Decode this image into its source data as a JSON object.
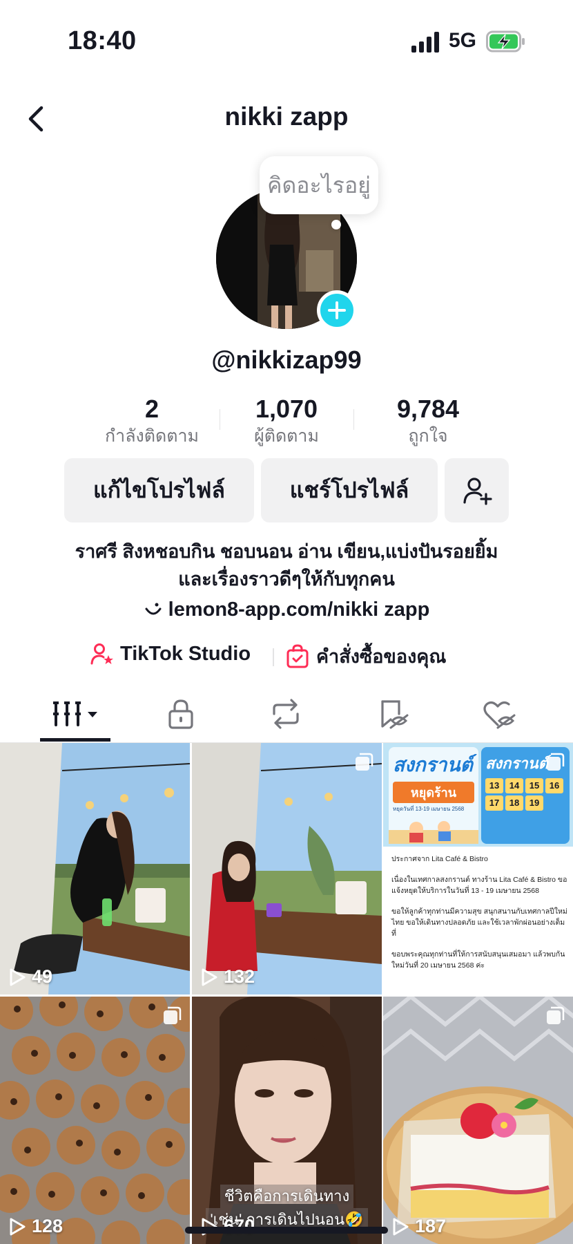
{
  "status_bar": {
    "time": "18:40",
    "network": "5G"
  },
  "header": {
    "title": "nikki zapp"
  },
  "profile": {
    "status_bubble": "คิดอะไรอยู่",
    "username": "@nikkizap99"
  },
  "stats": [
    {
      "value": "2",
      "label": "กำลังติดตาม"
    },
    {
      "value": "1,070",
      "label": "ผู้ติดตาม"
    },
    {
      "value": "9,784",
      "label": "ถูกใจ"
    }
  ],
  "buttons": {
    "edit": "แก้ไขโปรไฟล์",
    "share": "แชร์โปรไฟล์"
  },
  "bio": {
    "line1": "ราศรี สิงหชอบกิน ชอบนอน อ่าน เขียน,แบ่งปันรอยยิ้ม",
    "line2": "และเรื่องราวดีๆให้กับทุกคน",
    "link": "lemon8-app.com/nikki zapp"
  },
  "extras": {
    "studio": "TikTok Studio",
    "orders": "คำสั่งซื้อของคุณ"
  },
  "videos": [
    {
      "views": "49"
    },
    {
      "views": "132"
    },
    {
      "views": "",
      "poster_title": "สงกรานต์",
      "poster_closed": "หยุดร้าน",
      "poster_dates": "หยุดวันที่ 13-19 เมษายน 2568",
      "calendar_days": [
        "13",
        "14",
        "15",
        "16",
        "17",
        "18",
        "19"
      ],
      "notice_title": "ประกาศจาก Lita Café & Bistro",
      "notice_p1": "เนื่องในเทศกาลสงกรานต์ ทางร้าน Lita Café & Bistro ขอแจ้งหยุดให้บริการในวันที่ 13 - 19 เมษายน 2568",
      "notice_p2": "ขอให้ลูกค้าทุกท่านมีความสุข สนุกสนานกับเทศกาลปีใหม่ไทย ขอให้เดินทางปลอดภัย และใช้เวลาพักผ่อนอย่างเต็มที่",
      "notice_p3": "ขอบพระคุณทุกท่านที่ให้การสนับสนุนเสมอมา แล้วพบกันใหม่วันที่ 20 เมษายน 2568 ค่ะ"
    },
    {
      "views": "128"
    },
    {
      "views": "670",
      "caption1": "ชีวิตคือการเดินทาง",
      "caption2": "'เช่น' การเดินไปนอน🤣"
    },
    {
      "views": "187"
    }
  ],
  "colors": {
    "accent_cyan": "#20d5ec",
    "brand_pink": "#fe2c55",
    "text": "#161823"
  }
}
